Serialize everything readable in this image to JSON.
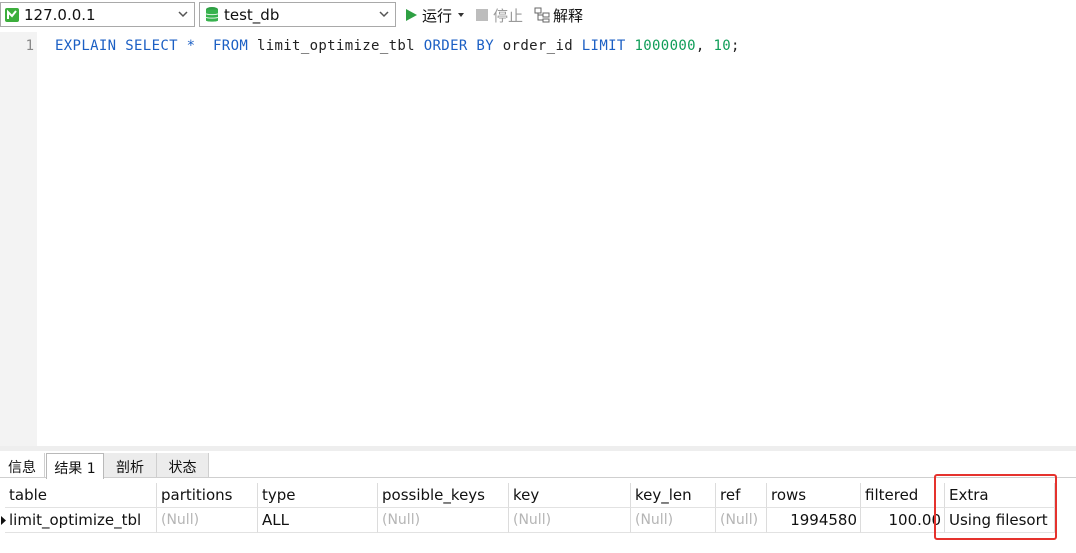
{
  "toolbar": {
    "connection": "127.0.0.1",
    "database": "test_db",
    "run_label": "运行",
    "stop_label": "停止",
    "explain_label": "解释"
  },
  "editor": {
    "line_number": "1",
    "tokens": {
      "t1": "EXPLAIN SELECT *",
      "t2": "FROM",
      "t3": "limit_optimize_tbl",
      "t4": "ORDER BY",
      "t5": "order_id",
      "t6": "LIMIT",
      "t7": "1000000",
      "t8": ", ",
      "t9": "10",
      "t10": ";"
    }
  },
  "result_tabs": {
    "info": "信息",
    "result1": "结果 1",
    "profile": "剖析",
    "status": "状态"
  },
  "grid": {
    "columns": [
      "table",
      "partitions",
      "type",
      "possible_keys",
      "key",
      "key_len",
      "ref",
      "rows",
      "filtered",
      "Extra"
    ],
    "row": {
      "table": "limit_optimize_tbl",
      "partitions": "(Null)",
      "type": "ALL",
      "possible_keys": "(Null)",
      "key": "(Null)",
      "key_len": "(Null)",
      "ref": "(Null)",
      "rows": "1994580",
      "filtered": "100.00",
      "extra": "Using filesort"
    }
  },
  "colors": {
    "keyword": "#1b5fc4",
    "number": "#0f9d58",
    "highlight": "#e5322d",
    "run_icon": "#2ea043"
  }
}
